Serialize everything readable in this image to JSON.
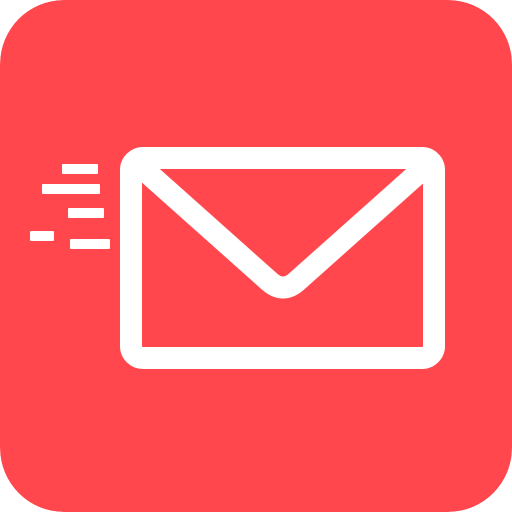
{
  "app_icon": {
    "name": "mail-app-icon",
    "icon": "envelope-icon",
    "motion": "speed-lines",
    "colors": {
      "background": "#FF474D",
      "foreground": "#FFFFFF"
    }
  }
}
